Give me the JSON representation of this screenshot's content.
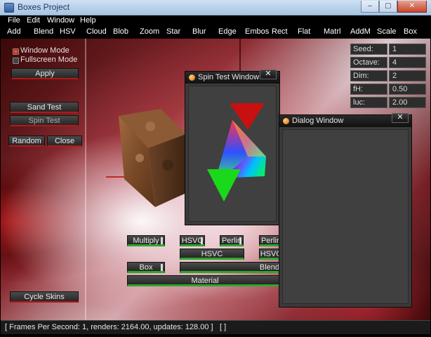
{
  "window": {
    "title": "Boxes Project",
    "minimize": "–",
    "maximize": "▢",
    "close": "✕"
  },
  "menu": [
    "File",
    "Edit",
    "Window",
    "Help"
  ],
  "toolbar": [
    "Add",
    "Blend",
    "HSV",
    "Cloud",
    "Blob",
    "Zoom",
    "Star",
    "Blur",
    "Edge",
    "Embos",
    "Rect",
    "Flat",
    "Matrl",
    "AddM",
    "Scale",
    "Box"
  ],
  "left_panel": {
    "window_mode": "Window Mode",
    "fullscreen_mode": "Fullscreen Mode",
    "apply": "Apply",
    "sand_test": "Sand Test",
    "spin_test": "Spin Test",
    "random": "Random",
    "close": "Close",
    "cycle_skins": "Cycle Skins"
  },
  "params": [
    {
      "label": "Seed:",
      "value": "1"
    },
    {
      "label": "Octave:",
      "value": "4"
    },
    {
      "label": "Dim:",
      "value": "2"
    },
    {
      "label": "fH:",
      "value": "0.50"
    },
    {
      "label": "luc:",
      "value": "2.00"
    }
  ],
  "spin_window": {
    "title": "Spin Test Window",
    "close": "✕"
  },
  "dialog_window": {
    "title": "Dialog Window",
    "close": "✕"
  },
  "nodes": {
    "multiply": "Multiply",
    "hsvc_small": "HSVC",
    "perlin1": "Perlin",
    "perlin2": "Perlin",
    "hsvc_wide": "HSVC",
    "hsvc_right": "HSVC",
    "box": "Box",
    "blend": "Blend",
    "material": "Material"
  },
  "status": {
    "text": "[ Frames Per Second: 1, renders: 2164.00, updates: 128.00 ]",
    "right": "[                                                   ]"
  }
}
